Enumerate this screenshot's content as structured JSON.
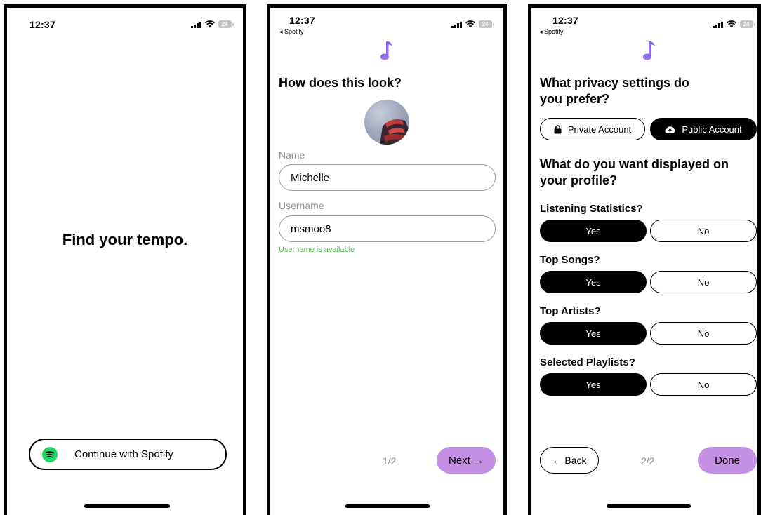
{
  "status": {
    "time": "12:37",
    "battery": "24",
    "back_app": "◂ Spotify"
  },
  "screen1": {
    "headline": "Find your tempo.",
    "continue_label": "Continue with Spotify"
  },
  "screen2": {
    "title": "How does this look?",
    "name_label": "Name",
    "name_value": "Michelle",
    "username_label": "Username",
    "username_value": "msmoo8",
    "username_helper": "Username is available",
    "page": "1/2",
    "next_label": "Next →"
  },
  "screen3": {
    "privacy_title_line1": "What privacy settings do",
    "privacy_title_line2": "you prefer?",
    "private_label": "Private Account",
    "public_label": "Public Account",
    "display_title_line1": "What do you want displayed on",
    "display_title_line2": "your profile?",
    "questions": [
      {
        "label": "Listening Statistics?",
        "yes": "Yes",
        "no": "No"
      },
      {
        "label": "Top Songs?",
        "yes": "Yes",
        "no": "No"
      },
      {
        "label": "Top Artists?",
        "yes": "Yes",
        "no": "No"
      },
      {
        "label": "Selected Playlists?",
        "yes": "Yes",
        "no": "No"
      }
    ],
    "back_label": "← Back",
    "page": "2/2",
    "done_label": "Done"
  },
  "colors": {
    "accent_purple": "#c58fe3",
    "note_gradient_top": "#8a5cf0",
    "note_gradient_bottom": "#a07ae8",
    "spotify_green": "#1ed760",
    "available_green": "#4cbb4c"
  }
}
